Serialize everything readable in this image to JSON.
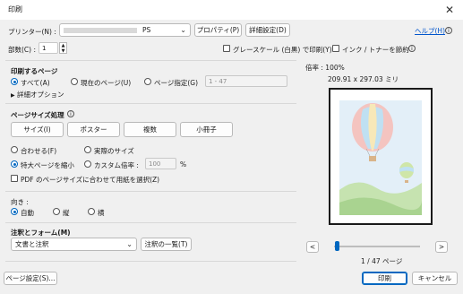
{
  "window": {
    "title": "印刷",
    "close_glyph": "✕"
  },
  "printer": {
    "label": "プリンター(N) :",
    "selected": "PS",
    "properties_button": "プロパティ(P)",
    "advanced_button": "詳細設定(D)",
    "help_link": "ヘルプ(H)"
  },
  "copies": {
    "label": "部数(C) :",
    "value": "1"
  },
  "options": {
    "grayscale_label": "グレースケール (白黒) で印刷(Y)",
    "save_ink_label": "インク / トナーを節約"
  },
  "pages_to_print": {
    "title": "印刷するページ",
    "all": "すべて(A)",
    "current": "現在のページ(U)",
    "range": "ページ指定(G)",
    "range_placeholder": "1 - 47",
    "more_options": "詳細オプション"
  },
  "page_sizing": {
    "title": "ページサイズ処理",
    "tabs": [
      "サイズ(I)",
      "ポスター",
      "複数",
      "小冊子"
    ],
    "fit": "合わせる(F)",
    "actual": "実際のサイズ",
    "shrink": "特大ページを縮小",
    "custom": "カスタム倍率 :",
    "custom_value": "100",
    "percent": "%",
    "pdf_paper": "PDF のページサイズに合わせて用紙を選択(Z)"
  },
  "orientation": {
    "title": "向き :",
    "auto": "自動",
    "portrait": "縦",
    "landscape": "横"
  },
  "comments": {
    "title": "注釈とフォーム(M)",
    "selected": "文書と注釈",
    "summary_button": "注釈の一覧(T)"
  },
  "preview": {
    "zoom": "倍率 : 100%",
    "size": "209.91 x 297.03 ミリ",
    "page_counter": "1 / 47 ページ",
    "prev": "<",
    "next": ">",
    "slider_position": 0.02
  },
  "footer": {
    "page_setup": "ページ設定(S)...",
    "print": "印刷",
    "cancel": "キャンセル"
  }
}
